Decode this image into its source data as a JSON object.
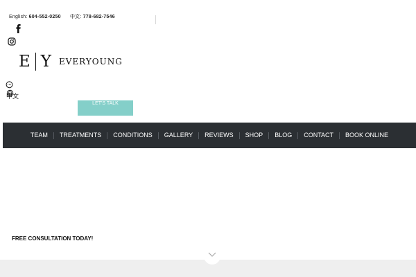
{
  "contact": {
    "english_label": "English:",
    "english_phone": "604-552-0250",
    "chinese_label": "中文:",
    "chinese_phone": "778-682-7546"
  },
  "logo": {
    "letter_e": "E",
    "letter_y": "Y",
    "wordmark": "EVERYOUNG"
  },
  "language": {
    "label": "中文"
  },
  "cta": {
    "lets_talk": "LET'S TALK"
  },
  "nav": {
    "items": [
      "TEAM",
      "TREATMENTS",
      "CONDITIONS",
      "GALLERY",
      "REVIEWS",
      "SHOP",
      "BLOG",
      "CONTACT",
      "BOOK ONLINE"
    ]
  },
  "hero": {
    "tagline": "FREE CONSULTATION TODAY!"
  },
  "colors": {
    "accent": "#84cfc9",
    "nav_bg": "#2b2f33",
    "footer_bg": "#efefef"
  },
  "icons": [
    "facebook-icon",
    "instagram-icon",
    "chat-icon",
    "globe-icon",
    "chevron-down-icon"
  ]
}
